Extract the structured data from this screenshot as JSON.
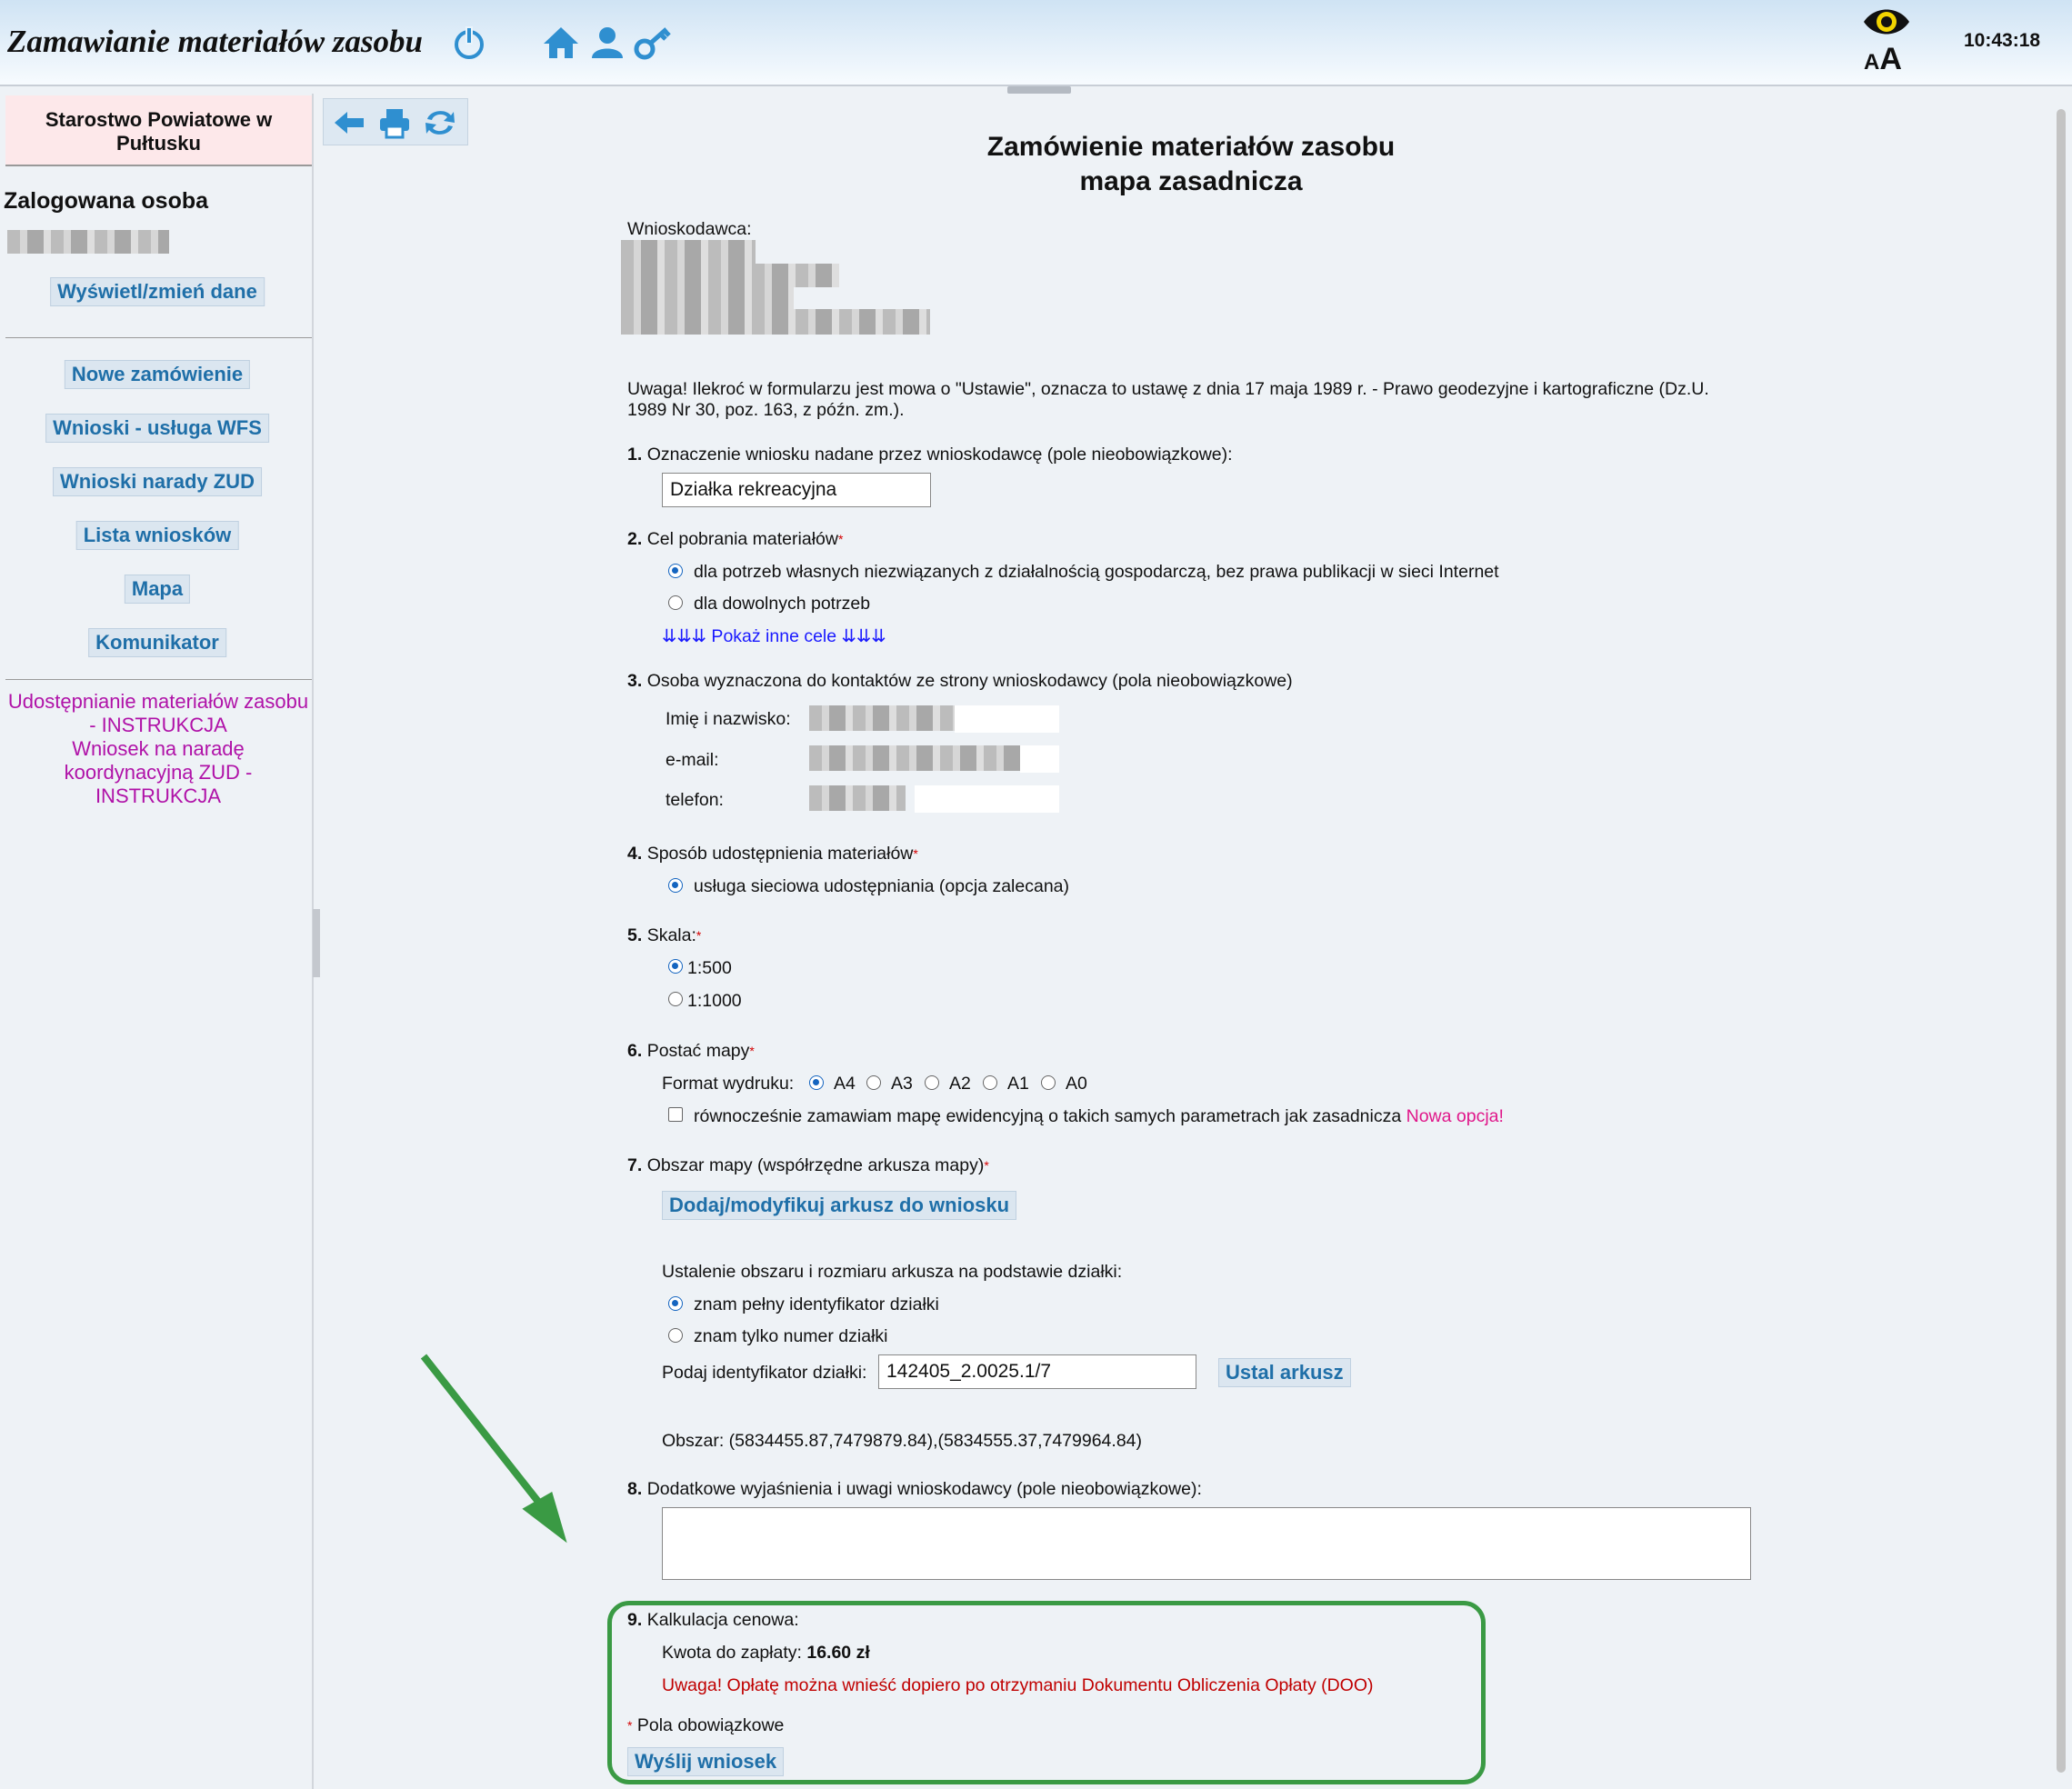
{
  "header": {
    "title": "Zamawianie materiałów zasobu",
    "clock": "10:43:18",
    "font_size_label_small": "A",
    "font_size_label_large": "A"
  },
  "sidebar": {
    "org_name_line1": "Starostwo Powiatowe w",
    "org_name_line2": "Pułtusku",
    "logged_label": "Zalogowana osoba",
    "edit_data": "Wyświetl/zmień dane",
    "items": [
      {
        "label": "Nowe zamówienie"
      },
      {
        "label": "Wnioski - usługa WFS"
      },
      {
        "label": "Wnioski narady ZUD"
      },
      {
        "label": "Lista wniosków"
      },
      {
        "label": "Mapa"
      },
      {
        "label": "Komunikator"
      }
    ],
    "instr1_line1": "Udostępnianie materiałów zasobu",
    "instr1_line2": "- INSTRUKCJA",
    "instr2_line1": "Wniosek na naradę",
    "instr2_line2": "koordynacyjną ZUD -",
    "instr2_line3": "INSTRUKCJA"
  },
  "page": {
    "title_line1": "Zamówienie materiałów zasobu",
    "title_line2": "mapa zasadnicza",
    "applicant_label": "Wnioskodawca:",
    "notice_line1": "Uwaga! Ilekroć w formularzu jest mowa o \"Ustawie\", oznacza to ustawę z dnia 17 maja 1989 r. - Prawo geodezyjne i kartograficzne (Dz.U.",
    "notice_line2": "1989 Nr 30, poz. 163, z późn. zm.).",
    "s1": {
      "num": "1.",
      "label": "Oznaczenie wniosku nadane przez wnioskodawcę (pole nieobowiązkowe):",
      "value": "Działka rekreacyjna"
    },
    "s2": {
      "num": "2.",
      "label": "Cel pobrania materiałów",
      "opt1": "dla potrzeb własnych niezwiązanych z działalnością gospodarczą, bez prawa publikacji w sieci Internet",
      "opt2": "dla dowolnych potrzeb",
      "show_more": "⇊⇊⇊ Pokaż inne cele ⇊⇊⇊"
    },
    "s3": {
      "num": "3.",
      "label": "Osoba wyznaczona do kontaktów ze strony wnioskodawcy (pola nieobowiązkowe)",
      "name": "Imię i nazwisko:",
      "email": "e-mail:",
      "phone": "telefon:"
    },
    "s4": {
      "num": "4.",
      "label": "Sposób udostępnienia materiałów",
      "opt1": "usługa sieciowa udostępniania (opcja zalecana)"
    },
    "s5": {
      "num": "5.",
      "label": "Skala:",
      "opt1": "1:500",
      "opt2": "1:1000"
    },
    "s6": {
      "num": "6.",
      "label": "Postać mapy",
      "format_label": "Format wydruku:",
      "formats": [
        "A4",
        "A3",
        "A2",
        "A1",
        "A0"
      ],
      "also_order": "równocześnie zamawiam mapę ewidencyjną o takich samych parametrach jak zasadnicza",
      "new_option": "Nowa opcja!"
    },
    "s7": {
      "num": "7.",
      "label": "Obszar mapy (współrzędne arkusza mapy)",
      "add_sheet": "Dodaj/modyfikuj arkusz do wniosku",
      "by_parcel": "Ustalenie obszaru i rozmiaru arkusza na podstawie działki:",
      "opt1": "znam pełny identyfikator działki",
      "opt2": "znam tylko numer działki",
      "id_label": "Podaj identyfikator działki:",
      "id_value": "142405_2.0025.1/7",
      "set_sheet": "Ustal arkusz",
      "area": "Obszar: (5834455.87,7479879.84),(5834555.37,7479964.84)"
    },
    "s8": {
      "num": "8.",
      "label": "Dodatkowe wyjaśnienia i uwagi wnioskodawcy (pole nieobowiązkowe):"
    },
    "s9": {
      "num": "9.",
      "label": "Kalkulacja cenowa:",
      "amount_label": "Kwota do zapłaty:",
      "amount": "16.60 zł",
      "warning": "Uwaga! Opłatę można wnieść dopiero po otrzymaniu Dokumentu Obliczenia Opłaty (DOO)"
    },
    "required_star": "*",
    "required_note": "Pola obowiązkowe",
    "submit": "Wyślij wniosek"
  },
  "colors": {
    "accent": "#1f6fa8",
    "highlight": "#3a9a44",
    "warning": "#c00000",
    "instruction": "#b012a8"
  }
}
